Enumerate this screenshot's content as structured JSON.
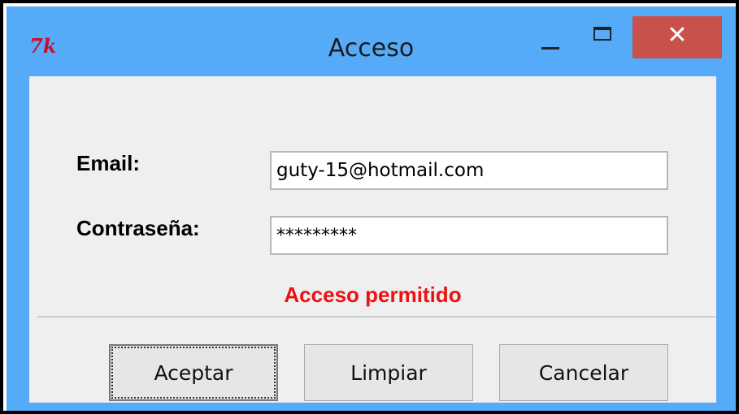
{
  "window": {
    "title": "Acceso",
    "app_icon_text": "7k",
    "controls": {
      "minimize_icon": "minimize-icon",
      "maximize_icon": "maximize-icon",
      "close_label": "✕"
    },
    "colors": {
      "titlebar": "#56abf9",
      "close_button": "#c9514b",
      "status_text": "#ee1111"
    }
  },
  "form": {
    "email": {
      "label": "Email:",
      "value": "guty-15@hotmail.com"
    },
    "password": {
      "label": "Contraseña:",
      "value": "*********"
    },
    "status": "Acceso permitido"
  },
  "buttons": {
    "accept": "Aceptar",
    "clear": "Limpiar",
    "cancel": "Cancelar"
  }
}
